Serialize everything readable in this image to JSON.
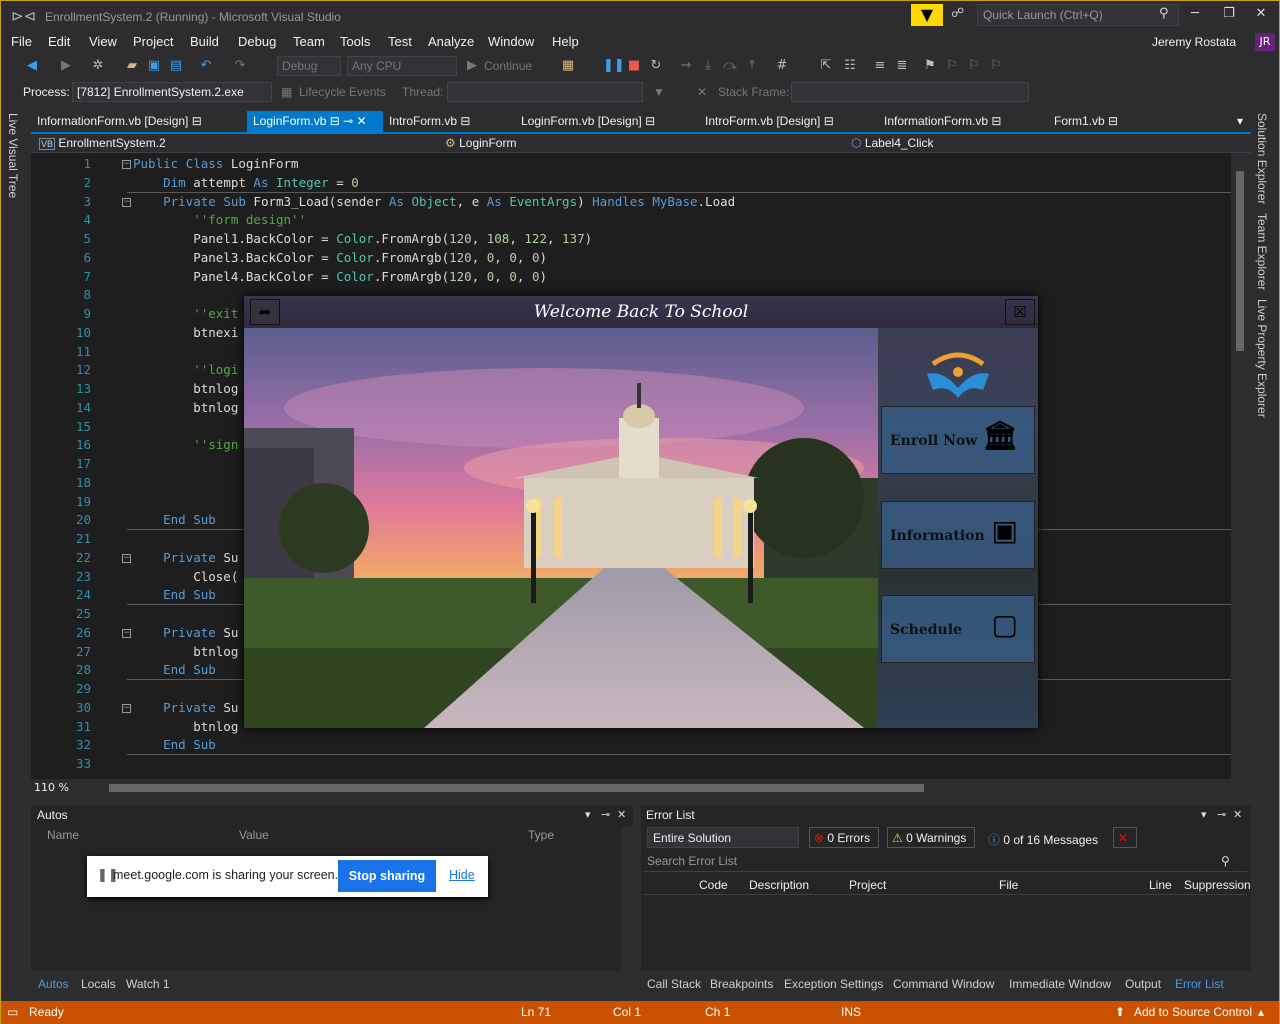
{
  "title": "EnrollmentSystem.2 (Running) - Microsoft Visual Studio",
  "quick_launch": {
    "placeholder": "Quick Launch (Ctrl+Q)"
  },
  "user": {
    "name": "Jeremy Rostata",
    "initials": "JR"
  },
  "menu": [
    "File",
    "Edit",
    "View",
    "Project",
    "Build",
    "Debug",
    "Team",
    "Tools",
    "Test",
    "Analyze",
    "Window",
    "Help"
  ],
  "toolbar": {
    "config": "Debug",
    "platform": "Any CPU",
    "continue": "Continue"
  },
  "process_bar": {
    "process_label": "Process:",
    "process_value": "[7812] EnrollmentSystem.2.exe",
    "lifecycle": "Lifecycle Events",
    "thread": "Thread:",
    "stack_frame": "Stack Frame:"
  },
  "side_tabs": {
    "left": "Live Visual Tree",
    "right": [
      "Solution Explorer",
      "Team Explorer",
      "Live Property Explorer"
    ]
  },
  "doc_tabs": [
    "InformationForm.vb [Design]",
    "LoginForm.vb",
    "IntroForm.vb",
    "LoginForm.vb [Design]",
    "IntroForm.vb [Design]",
    "InformationForm.vb",
    "Form1.vb"
  ],
  "nav": {
    "project": "EnrollmentSystem.2",
    "class": "LoginForm",
    "member": "Label4_Click"
  },
  "code_lines": [
    {
      "n": "1",
      "t": "Public Class LoginForm"
    },
    {
      "n": "2",
      "t": "    Dim attempt As Integer = 0"
    },
    {
      "n": "3",
      "t": "    Private Sub Form3_Load(sender As Object, e As EventArgs) Handles MyBase.Load"
    },
    {
      "n": "4",
      "t": "        ''form design''"
    },
    {
      "n": "5",
      "t": "        Panel1.BackColor = Color.FromArgb(120, 108, 122, 137)"
    },
    {
      "n": "6",
      "t": "        Panel3.BackColor = Color.FromArgb(120, 0, 0, 0)"
    },
    {
      "n": "7",
      "t": "        Panel4.BackColor = Color.FromArgb(120, 0, 0, 0)"
    },
    {
      "n": "8",
      "t": ""
    },
    {
      "n": "9",
      "t": "        ''exit"
    },
    {
      "n": "10",
      "t": "        btnexi"
    },
    {
      "n": "11",
      "t": ""
    },
    {
      "n": "12",
      "t": "        ''logi"
    },
    {
      "n": "13",
      "t": "        btnlog"
    },
    {
      "n": "14",
      "t": "        btnlog"
    },
    {
      "n": "15",
      "t": ""
    },
    {
      "n": "16",
      "t": "        ''sign"
    },
    {
      "n": "17",
      "t": ""
    },
    {
      "n": "18",
      "t": ""
    },
    {
      "n": "19",
      "t": ""
    },
    {
      "n": "20",
      "t": "    End Sub"
    },
    {
      "n": "21",
      "t": ""
    },
    {
      "n": "22",
      "t": "    Private Su"
    },
    {
      "n": "23",
      "t": "        Close("
    },
    {
      "n": "24",
      "t": "    End Sub"
    },
    {
      "n": "25",
      "t": ""
    },
    {
      "n": "26",
      "t": "    Private Su"
    },
    {
      "n": "27",
      "t": "        btnlog"
    },
    {
      "n": "28",
      "t": "    End Sub"
    },
    {
      "n": "29",
      "t": ""
    },
    {
      "n": "30",
      "t": "    Private Su"
    },
    {
      "n": "31",
      "t": "        btnlog"
    },
    {
      "n": "32",
      "t": "    End Sub"
    },
    {
      "n": "33",
      "t": ""
    }
  ],
  "zoom": "110 %",
  "login_form": {
    "title": "Welcome Back To School",
    "buttons": [
      "Enroll Now",
      "Information",
      "Schedule"
    ]
  },
  "autos": {
    "title": "Autos",
    "cols": [
      "Name",
      "Value",
      "Type"
    ]
  },
  "share": {
    "text": "meet.google.com is sharing your screen.",
    "stop": "Stop sharing",
    "hide": "Hide"
  },
  "error_list": {
    "title": "Error List",
    "scope": "Entire Solution",
    "errors": "0 Errors",
    "warnings": "0 Warnings",
    "messages": "0 of 16 Messages",
    "search": "Search Error List",
    "cols": [
      "Code",
      "Description",
      "Project",
      "File",
      "Line",
      "Suppression"
    ]
  },
  "bottom_tabs_left": [
    "Autos",
    "Locals",
    "Watch 1"
  ],
  "bottom_tabs_right": [
    "Call Stack",
    "Breakpoints",
    "Exception Settings",
    "Command Window",
    "Immediate Window",
    "Output",
    "Error List"
  ],
  "status": {
    "ready": "Ready",
    "ln": "Ln 71",
    "col": "Col 1",
    "ch": "Ch 1",
    "ins": "INS",
    "source": "Add to Source Control"
  }
}
